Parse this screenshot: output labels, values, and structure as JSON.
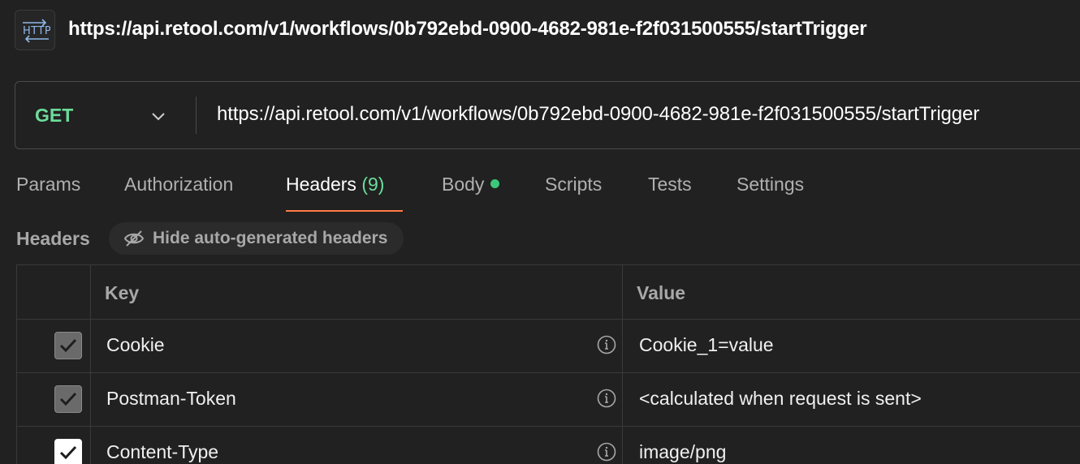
{
  "title": {
    "icon": "http-icon",
    "url": "https://api.retool.com/v1/workflows/0b792ebd-0900-4682-981e-f2f031500555/startTrigger"
  },
  "request": {
    "method": "GET",
    "method_icon": "chevron-down-icon",
    "url": "https://api.retool.com/v1/workflows/0b792ebd-0900-4682-981e-f2f031500555/startTrigger"
  },
  "tabs": [
    {
      "label": "Params"
    },
    {
      "label": "Authorization"
    },
    {
      "label": "Headers",
      "count": "(9)",
      "active": true
    },
    {
      "label": "Body",
      "dot_color": "#3cc87a"
    },
    {
      "label": "Scripts"
    },
    {
      "label": "Tests"
    },
    {
      "label": "Settings"
    }
  ],
  "headers_section": {
    "label": "Headers",
    "toggle_label": "Hide auto-generated headers",
    "toggle_icon": "eye-off-icon"
  },
  "table": {
    "columns": {
      "key": "Key",
      "value": "Value"
    },
    "rows": [
      {
        "checked": true,
        "auto": true,
        "key": "Cookie",
        "value": "Cookie_1=value"
      },
      {
        "checked": true,
        "auto": true,
        "key": "Postman-Token",
        "value": "<calculated when request is sent>"
      },
      {
        "checked": true,
        "auto": false,
        "key": "Content-Type",
        "value": "image/png"
      }
    ]
  },
  "colors": {
    "background": "#212121",
    "method_green": "#6bdd9a",
    "active_tab_underline": "#ff7a45"
  }
}
